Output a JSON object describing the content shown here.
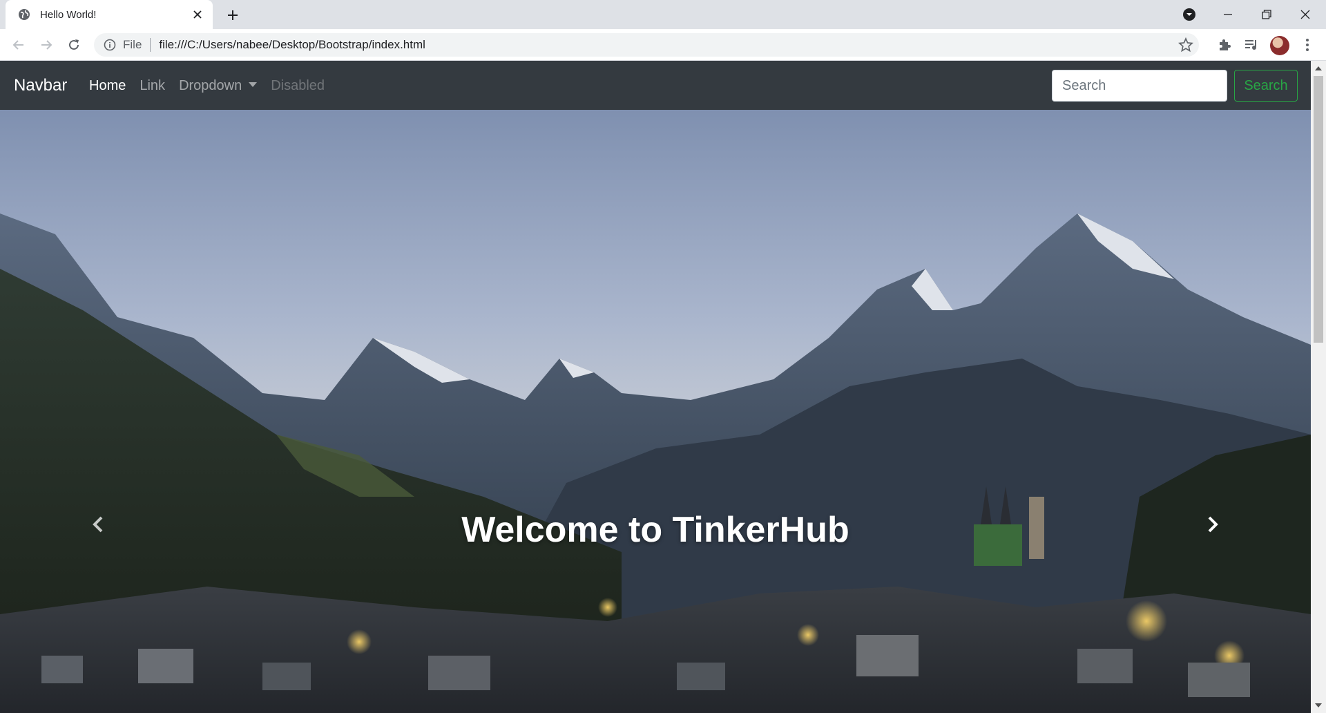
{
  "browser": {
    "tab_title": "Hello World!",
    "omnibox_scheme": "File",
    "omnibox_url": "file:///C:/Users/nabee/Desktop/Bootstrap/index.html"
  },
  "navbar": {
    "brand": "Navbar",
    "links": [
      {
        "label": "Home",
        "state": "active"
      },
      {
        "label": "Link",
        "state": "normal"
      },
      {
        "label": "Dropdown",
        "state": "dropdown"
      },
      {
        "label": "Disabled",
        "state": "disabled"
      }
    ],
    "search_placeholder": "Search",
    "search_button": "Search"
  },
  "carousel": {
    "caption": "Welcome to TinkerHub",
    "prev_icon": "chevron-left-icon",
    "next_icon": "chevron-right-icon"
  },
  "colors": {
    "navbar_bg": "#343a40",
    "search_button": "#28a745"
  }
}
